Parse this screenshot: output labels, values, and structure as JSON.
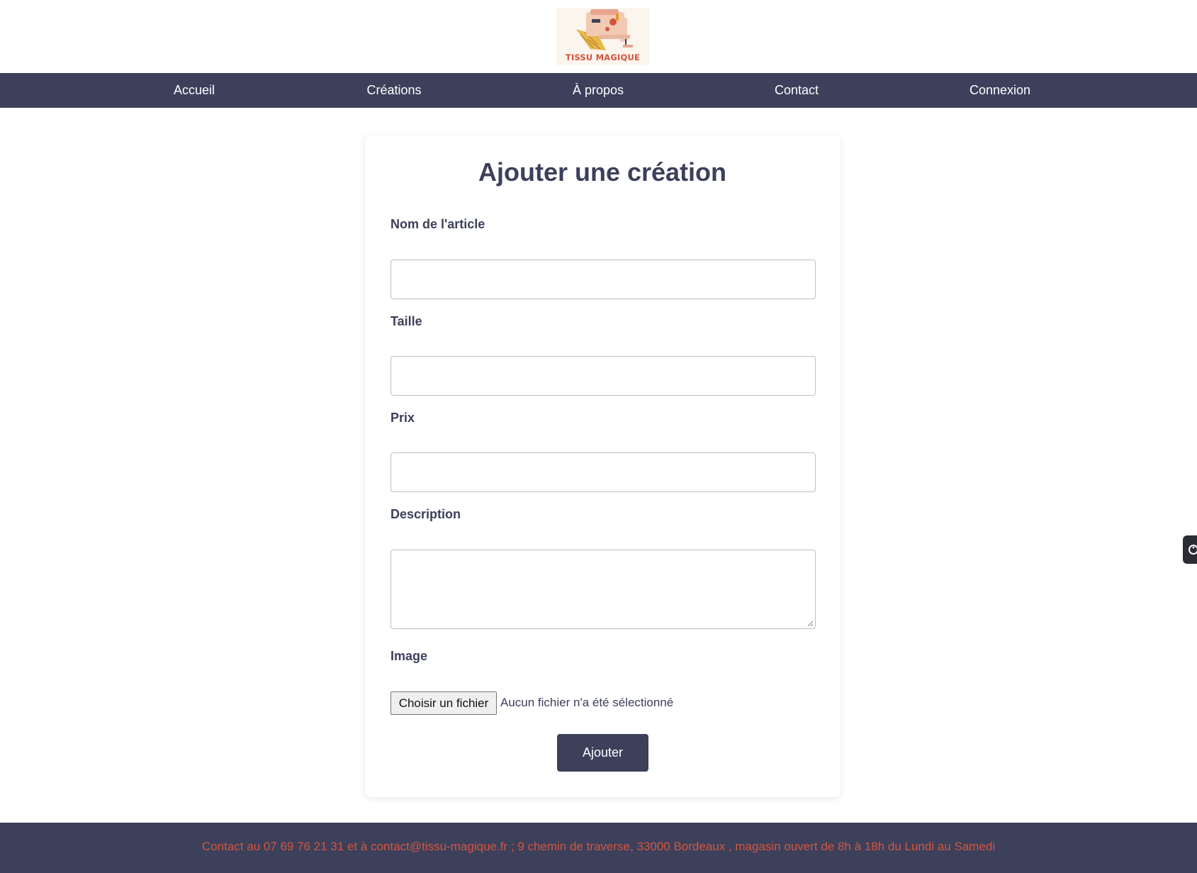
{
  "logo": {
    "text": "TISSU MAGIQUE",
    "icon": "sewing-machine-logo"
  },
  "nav": {
    "items": [
      {
        "label": "Accueil"
      },
      {
        "label": "Créations"
      },
      {
        "label": "À propos"
      },
      {
        "label": "Contact"
      },
      {
        "label": "Connexion"
      }
    ]
  },
  "form": {
    "title": "Ajouter une création",
    "fields": {
      "name_label": "Nom de l'article",
      "name_value": "",
      "size_label": "Taille",
      "size_value": "",
      "price_label": "Prix",
      "price_value": "",
      "description_label": "Description",
      "description_value": "",
      "image_label": "Image"
    },
    "file_button": "Choisir un fichier",
    "file_status": "Aucun fichier n'a été sélectionné",
    "submit_label": "Ajouter"
  },
  "side_widget": {
    "icon": "accessibility-icon"
  },
  "footer": {
    "text": "Contact au 07 69 76 21 31 et à contact@tissu-magique.fr ; 9 chemin de traverse, 33000 Bordeaux , magasin ouvert de 8h à 18h du Lundi au Samedi"
  },
  "colors": {
    "nav_background": "#3c405b",
    "footer_text": "#d4553e",
    "button_background": "#3c405b",
    "page_background": "#ffffff"
  }
}
